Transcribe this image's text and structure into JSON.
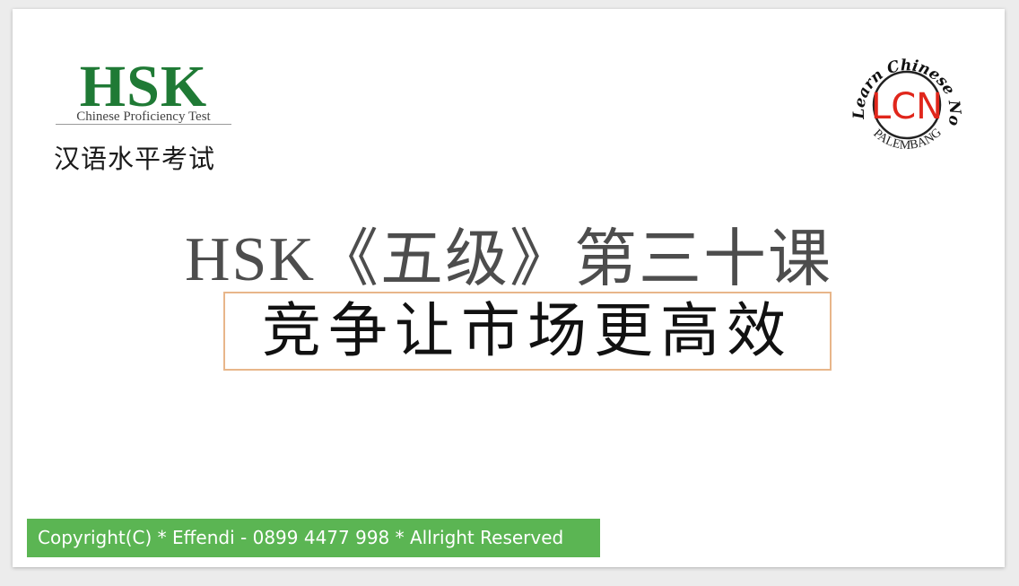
{
  "hsk_logo": {
    "wordmark": "HSK",
    "subtitle": "Chinese Proficiency Test",
    "chinese_name": "汉语水平考试",
    "brand_color": "#1f7a35"
  },
  "lcn_logo": {
    "arc_text": "Learn Chinese Now",
    "initials": "LCN",
    "city": "PALEMBANG",
    "accent_color": "#e0261b"
  },
  "lesson": {
    "title": "HSK《五级》第三十课",
    "topic": "竞争让市场更高效"
  },
  "footer": {
    "copyright": "Copyright(C) * Effendi - 0899 4477 998 * Allright Reserved",
    "bar_color": "#5bb553"
  }
}
